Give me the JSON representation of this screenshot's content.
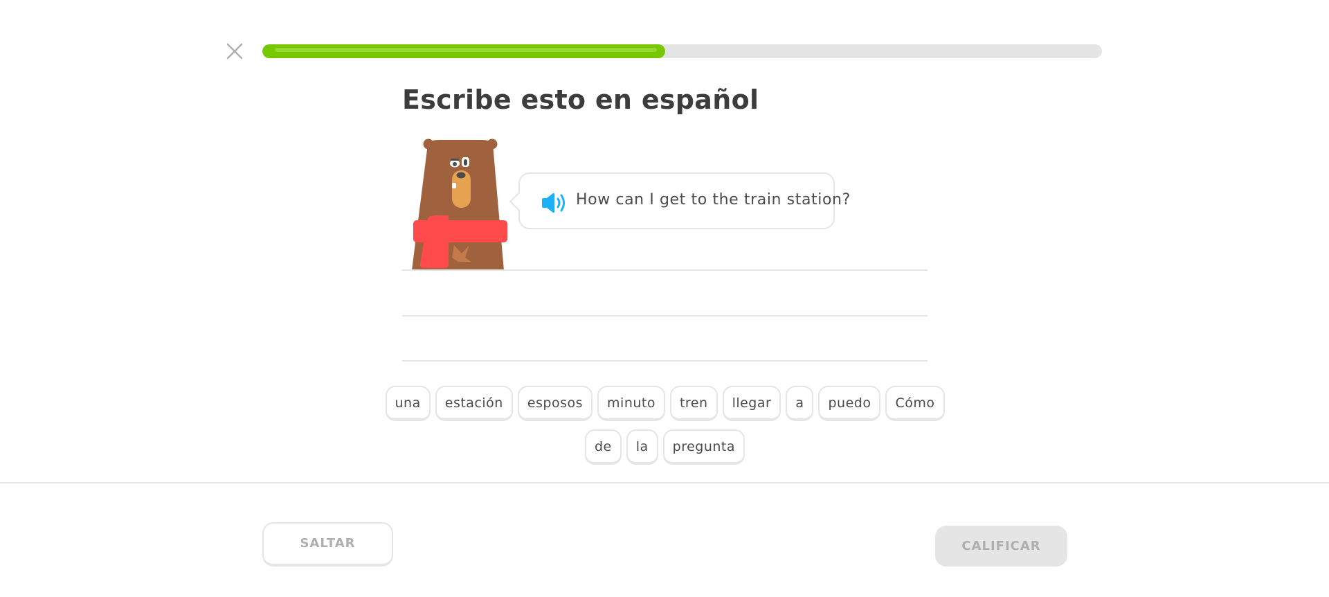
{
  "header": {
    "close_icon": "close-icon",
    "progress_fraction": 0.48,
    "colors": {
      "progress_fill": "#78c800",
      "progress_track": "#e5e5e5"
    }
  },
  "exercise": {
    "title": "Escribe esto en español",
    "character": "bear-with-red-scarf",
    "prompt": {
      "speaker_icon": "speaker-icon",
      "text": "How can I get to the train station?"
    }
  },
  "word_bank": {
    "rows": [
      [
        "una",
        "estación",
        "esposos",
        "minuto",
        "tren",
        "llegar",
        "a",
        "puedo",
        "Cómo"
      ],
      [
        "de",
        "la",
        "pregunta"
      ]
    ]
  },
  "footer": {
    "skip_label": "SALTAR",
    "check_label": "CALIFICAR"
  }
}
